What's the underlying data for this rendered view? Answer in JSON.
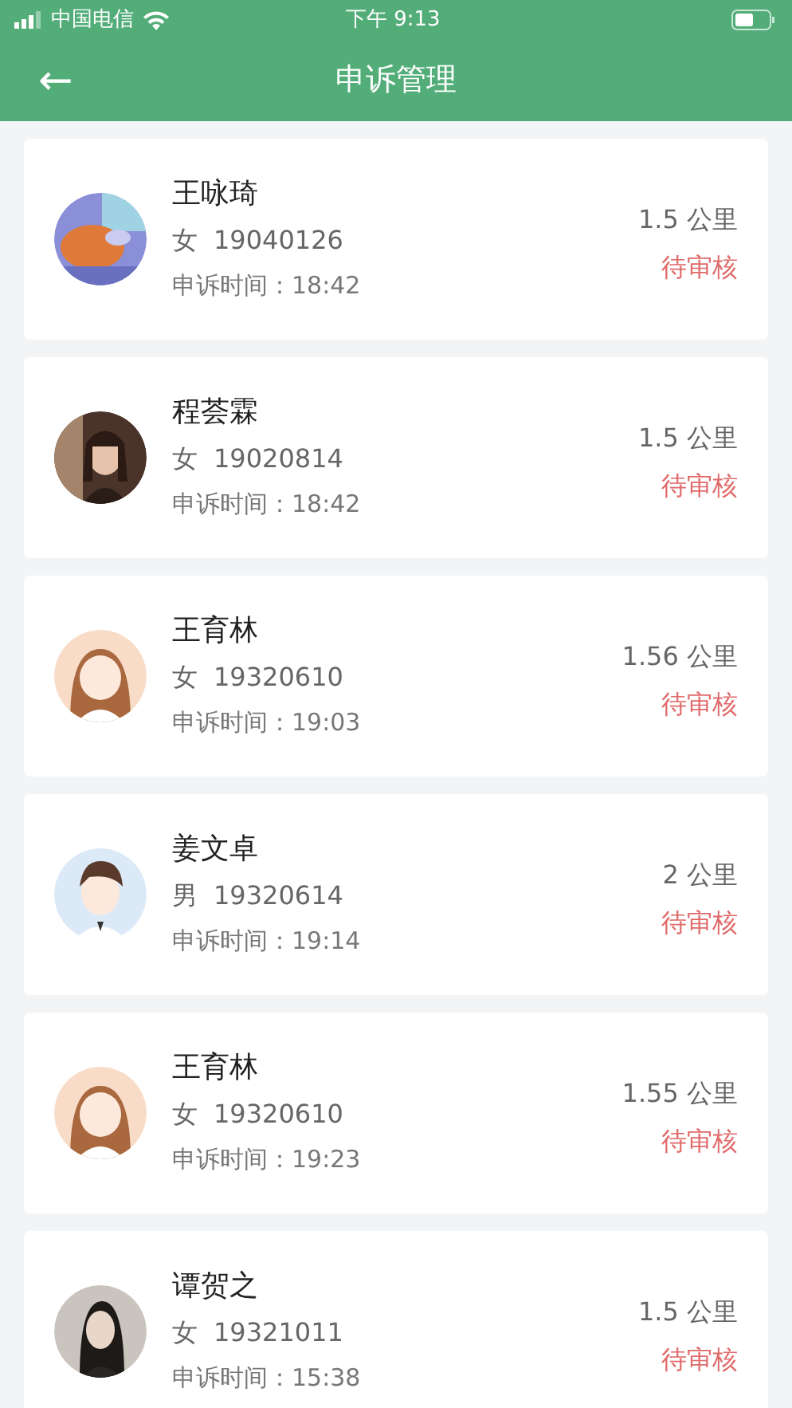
{
  "status_bar": {
    "carrier": "中国电信",
    "time": "下午 9:13"
  },
  "header": {
    "back": "←",
    "title": "申诉管理"
  },
  "appeals": [
    {
      "name": "王咏琦",
      "gender": "女",
      "id": "19040126",
      "time_label": "申诉时间：",
      "time": "18:42",
      "distance": "1.5 公里",
      "status": "待审核"
    },
    {
      "name": "程荟霖",
      "gender": "女",
      "id": "19020814",
      "time_label": "申诉时间：",
      "time": "18:42",
      "distance": "1.5 公里",
      "status": "待审核"
    },
    {
      "name": "王育林",
      "gender": "女",
      "id": "19320610",
      "time_label": "申诉时间：",
      "time": "19:03",
      "distance": "1.56 公里",
      "status": "待审核"
    },
    {
      "name": "姜文卓",
      "gender": "男",
      "id": "19320614",
      "time_label": "申诉时间：",
      "time": "19:14",
      "distance": "2 公里",
      "status": "待审核"
    },
    {
      "name": "王育林",
      "gender": "女",
      "id": "19320610",
      "time_label": "申诉时间：",
      "time": "19:23",
      "distance": "1.55 公里",
      "status": "待审核"
    },
    {
      "name": "谭贺之",
      "gender": "女",
      "id": "19321011",
      "time_label": "申诉时间：",
      "time": "15:38",
      "distance": "1.5 公里",
      "status": "待审核"
    }
  ]
}
